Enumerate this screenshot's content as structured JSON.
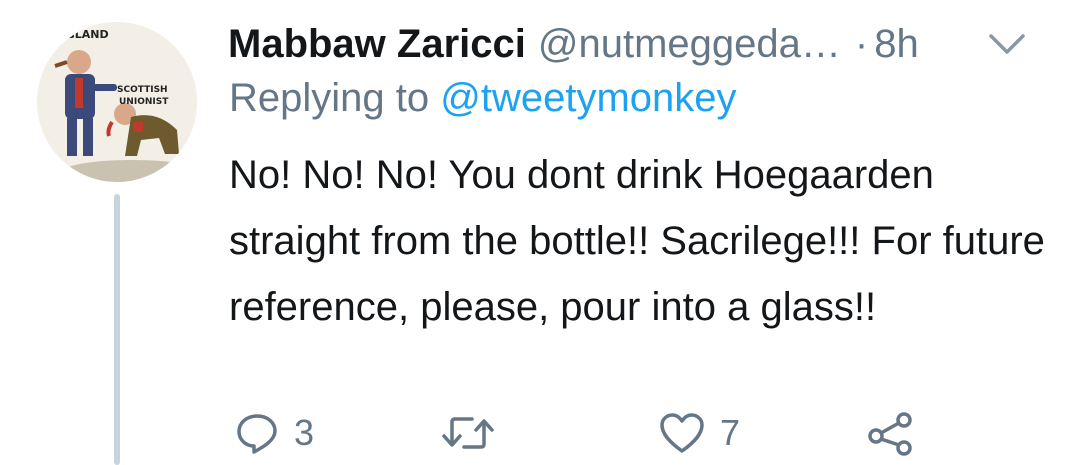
{
  "tweet": {
    "author_name": "Mabbaw Zaricci",
    "author_handle": "@nutmeggeda…",
    "separator": "·",
    "time": "8h",
    "replying_prefix": "Replying to",
    "replying_to": "@tweetymonkey",
    "text": "No! No! No! You dont drink Hoegaarden straight from the bottle!! Sacrilege!!! For future reference, please, pour into a glass!!"
  },
  "avatar": {
    "label_top": "ENGLAND",
    "label_scottish": "SCOTTISH",
    "label_unionist": "UNIONIST"
  },
  "actions": {
    "reply_count": "3",
    "retweet_count": "",
    "like_count": "7"
  },
  "icons": {
    "reply": "reply-icon",
    "retweet": "retweet-icon",
    "like": "heart-icon",
    "share": "share-icon",
    "menu": "chevron-down-icon"
  },
  "colors": {
    "text": "#14171a",
    "secondary": "#657786",
    "link": "#1da1f2",
    "thread_line": "#c8d3dd"
  }
}
